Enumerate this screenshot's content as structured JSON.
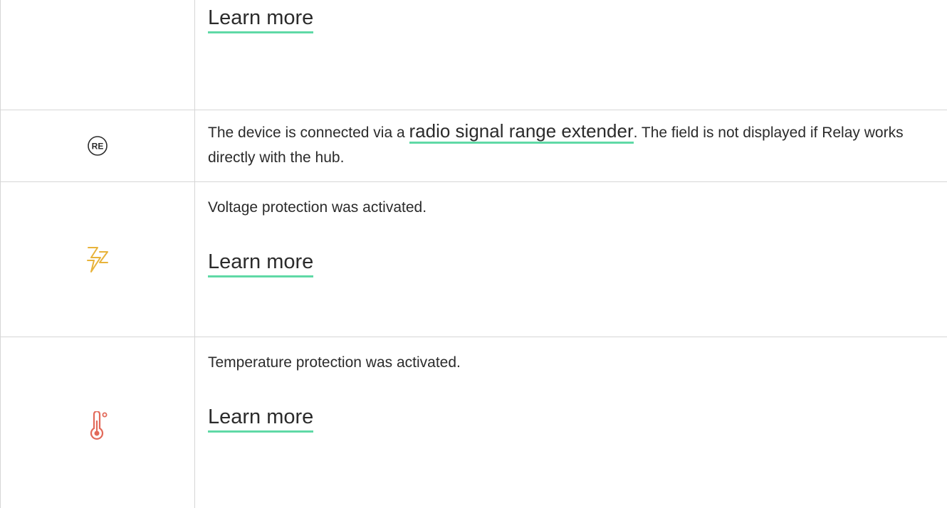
{
  "rows": [
    {
      "icon": "none",
      "learn_more": "Learn more"
    },
    {
      "icon": "re-extender-icon",
      "desc_before": "The device is connected via a ",
      "link": "radio signal range extender",
      "desc_after": ". The field is not displayed if Relay works directly with the hub."
    },
    {
      "icon": "voltage-icon",
      "desc": "Voltage protection was activated.",
      "learn_more": "Learn more"
    },
    {
      "icon": "thermometer-icon",
      "desc": "Temperature protection was activated.",
      "learn_more": "Learn more"
    }
  ],
  "icon_labels": {
    "re": "RE"
  },
  "colors": {
    "link_underline": "#5fd9a6",
    "voltage": "#e8b33a",
    "temperature": "#e26a5a",
    "border": "#d6d6d6"
  }
}
